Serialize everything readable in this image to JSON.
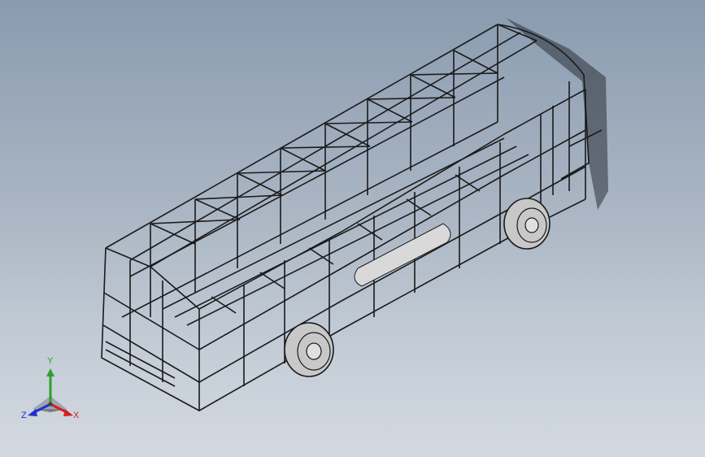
{
  "view": {
    "colors": {
      "background_top": "#8a9bb0",
      "background_bottom": "#d3d9e0",
      "frame_line": "#1a1a1a",
      "tube_fill": "#d9d9d9",
      "wheel_fill": "#c8c8c8",
      "shadow": "#2a2f38"
    }
  },
  "triad": {
    "x_label": "X",
    "y_label": "Y",
    "z_label": "Z",
    "x_color": "#d42020",
    "y_color": "#2ca02c",
    "z_color": "#2030d0"
  }
}
